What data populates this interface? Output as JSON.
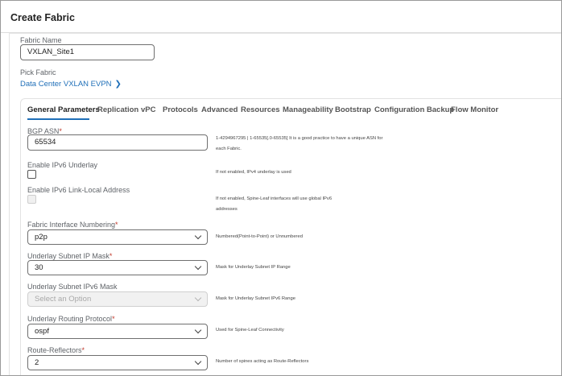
{
  "dialog": {
    "title": "Create Fabric"
  },
  "fabric_name": {
    "label": "Fabric Name",
    "value": "VXLAN_Site1"
  },
  "pick_fabric": {
    "label": "Pick Fabric",
    "link": "Data Center VXLAN EVPN",
    "chevron": "chevron-right-icon"
  },
  "tabs": [
    {
      "label": "General Parameters",
      "active": true
    },
    {
      "label": "Replication"
    },
    {
      "label": "vPC"
    },
    {
      "label": "Protocols"
    },
    {
      "label": "Advanced"
    },
    {
      "label": "Resources"
    },
    {
      "label": "Manageability"
    },
    {
      "label": "Bootstrap"
    },
    {
      "label": "Configuration Backup"
    },
    {
      "label": "Flow Monitor"
    }
  ],
  "fields": {
    "bgp_asn": {
      "label": "BGP ASN",
      "required": "*",
      "value": "65534",
      "help_line1": "1-4294967295 | 1-65535[.0-65535] It is a good practice to have a unique ASN for",
      "help_line2": "each Fabric."
    },
    "ipv6_underlay": {
      "label": "Enable IPv6 Underlay",
      "help": "If not enabled, IPv4 underlay is used"
    },
    "ipv6_link_local": {
      "label": "Enable IPv6 Link-Local Address",
      "help_line1": "If not enabled, Spine-Leaf interfaces will use global IPv6",
      "help_line2": "addresses"
    },
    "interface_numbering": {
      "label": "Fabric Interface Numbering",
      "required": "*",
      "value": "p2p",
      "help": "Numbered(Point-to-Point) or Unnumbered"
    },
    "subnet_ip_mask": {
      "label": "Underlay Subnet IP Mask",
      "required": "*",
      "value": "30",
      "help": "Mask for Underlay Subnet IP Range"
    },
    "subnet_ipv6_mask": {
      "label": "Underlay Subnet IPv6 Mask",
      "placeholder": "Select an Option",
      "help": "Mask for Underlay Subnet IPv6 Range"
    },
    "routing_protocol": {
      "label": "Underlay Routing Protocol",
      "required": "*",
      "value": "ospf",
      "help": "Used for Spine-Leaf Connectivity"
    },
    "route_reflectors": {
      "label": "Route-Reflectors",
      "required": "*",
      "value": "2",
      "help": "Number of spines acting as Route-Reflectors"
    }
  },
  "colors": {
    "accent": "#1f6fb8",
    "required": "#c0392b"
  }
}
